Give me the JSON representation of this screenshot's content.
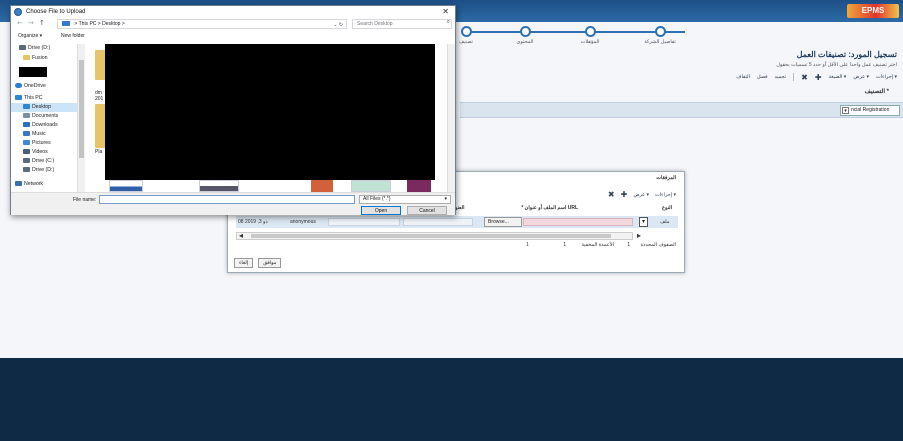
{
  "app": {
    "logo_text": "EPMS",
    "wizard_steps": [
      {
        "label": "تصنيف"
      },
      {
        "label": "المحتوى"
      },
      {
        "label": "المؤهلات"
      },
      {
        "label": "تفاصيل الشركة"
      }
    ],
    "page_title": "تسجيل المورد: تصنيفات العمل",
    "page_instructions": "اختر تصنيف عمل واحدا على الأقل أو حدد 5 تسميات بحقول",
    "toolbar": {
      "actions_label": "إجراءات",
      "view_label": "عرض",
      "format_label": "الصيغة",
      "freeze_label": "تجميد",
      "detach_label": "فصل",
      "wrap_label": "التفاف"
    },
    "classification_label": "* التصنيف",
    "classification_value": "ncial Registration"
  },
  "modal": {
    "title": "المرفقات",
    "toolbar": {
      "actions_label": "إجراءات",
      "view_label": "عرض"
    },
    "columns": {
      "type": "النوع",
      "file_or_url": "* اسم الملف أو عنوان URL",
      "title": "العنوان"
    },
    "row": {
      "date": "08 2019 ,ذو 3",
      "user": "anonymous",
      "browse_label": "Browse...",
      "type_value": "ملف"
    },
    "pager": {
      "selected_label": "الصفوف المحددة",
      "selected_count": "1",
      "total_label": "الأعمدة المخفية",
      "total_count": "1",
      "extra_count": "1"
    },
    "ok_label": "موافق",
    "cancel_label": "إلغاء"
  },
  "dialog": {
    "title": "Choose File to Upload",
    "breadcrumb": "> This PC > Desktop >",
    "search_placeholder": "Search Desktop",
    "organize_label": "Organize ▾",
    "new_folder_label": "New folder",
    "nav_items": [
      {
        "label": "Drive (D:)",
        "icon": "drive-icon",
        "color": "#5a6b7c"
      },
      {
        "label": "Fusion",
        "icon": "folder-icon",
        "color": "#e8c468"
      },
      {
        "label": "",
        "icon": "redacted",
        "color": "#000000"
      },
      {
        "label": "OneDrive",
        "icon": "cloud-icon",
        "color": "#2b7fd5"
      },
      {
        "label": "This PC",
        "icon": "pc-icon",
        "color": "#2f86d6"
      },
      {
        "label": "Desktop",
        "icon": "desktop-icon",
        "color": "#2f86d6"
      },
      {
        "label": "Documents",
        "icon": "documents-icon",
        "color": "#7a8fa5"
      },
      {
        "label": "Downloads",
        "icon": "downloads-icon",
        "color": "#2a6fc4"
      },
      {
        "label": "Music",
        "icon": "music-icon",
        "color": "#3f76c1"
      },
      {
        "label": "Pictures",
        "icon": "pictures-icon",
        "color": "#3f8ad8"
      },
      {
        "label": "Videos",
        "icon": "videos-icon",
        "color": "#4a5f78"
      },
      {
        "label": "Drive (C:)",
        "icon": "drive-icon",
        "color": "#5a6b7c"
      },
      {
        "label": "Drive (D:)",
        "icon": "drive-icon",
        "color": "#5a6b7c"
      },
      {
        "label": "Network",
        "icon": "network-icon",
        "color": "#3b6fa8"
      }
    ],
    "file_label_1a": "dm",
    "file_label_1b": "201",
    "file_label_2": "Pla",
    "filename_label": "File name:",
    "filename_value": "",
    "filetype_value": "All Files (*.*)",
    "open_label": "Open",
    "cancel_label": "Cancel"
  }
}
